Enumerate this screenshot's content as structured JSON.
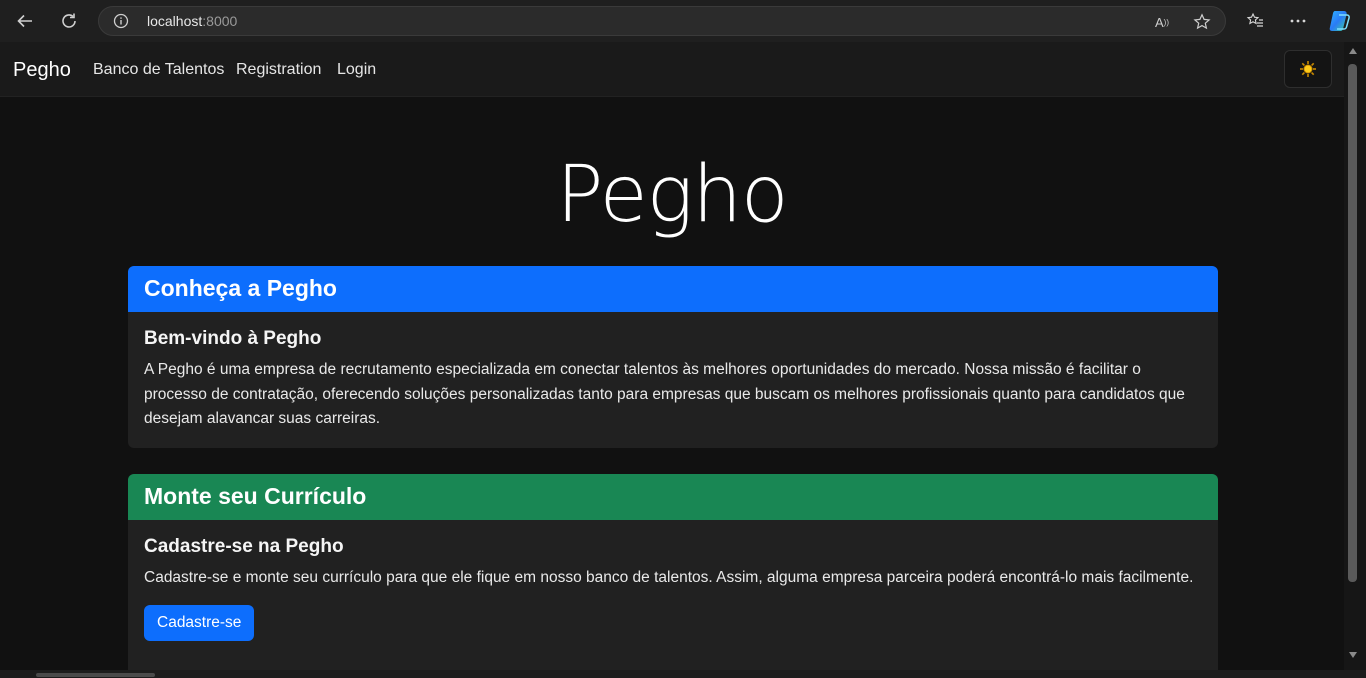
{
  "browser": {
    "url_host": "localhost",
    "url_port": ":8000"
  },
  "navbar": {
    "brand": "Pegho",
    "links": [
      "Banco de Talentos",
      "Registration",
      "Login"
    ],
    "theme_icon": "sun-icon"
  },
  "hero": {
    "title": "Pegho"
  },
  "cards": [
    {
      "header": "Conheça a Pegho",
      "header_color": "#0d6efd",
      "title": "Bem-vindo à Pegho",
      "text": "A Pegho é uma empresa de recrutamento especializada em conectar talentos às melhores oportunidades do mercado. Nossa missão é facilitar o processo de contratação, oferecendo soluções personalizadas tanto para empresas que buscam os melhores profissionais quanto para candidatos que desejam alavancar suas carreiras."
    },
    {
      "header": "Monte seu Currículo",
      "header_color": "#198754",
      "title": "Cadastre-se na Pegho",
      "text": "Cadastre-se e monte seu currículo para que ele fique em nosso banco de talentos. Assim, alguma empresa parceira poderá encontrá-lo mais facilmente.",
      "button": "Cadastre-se"
    }
  ]
}
